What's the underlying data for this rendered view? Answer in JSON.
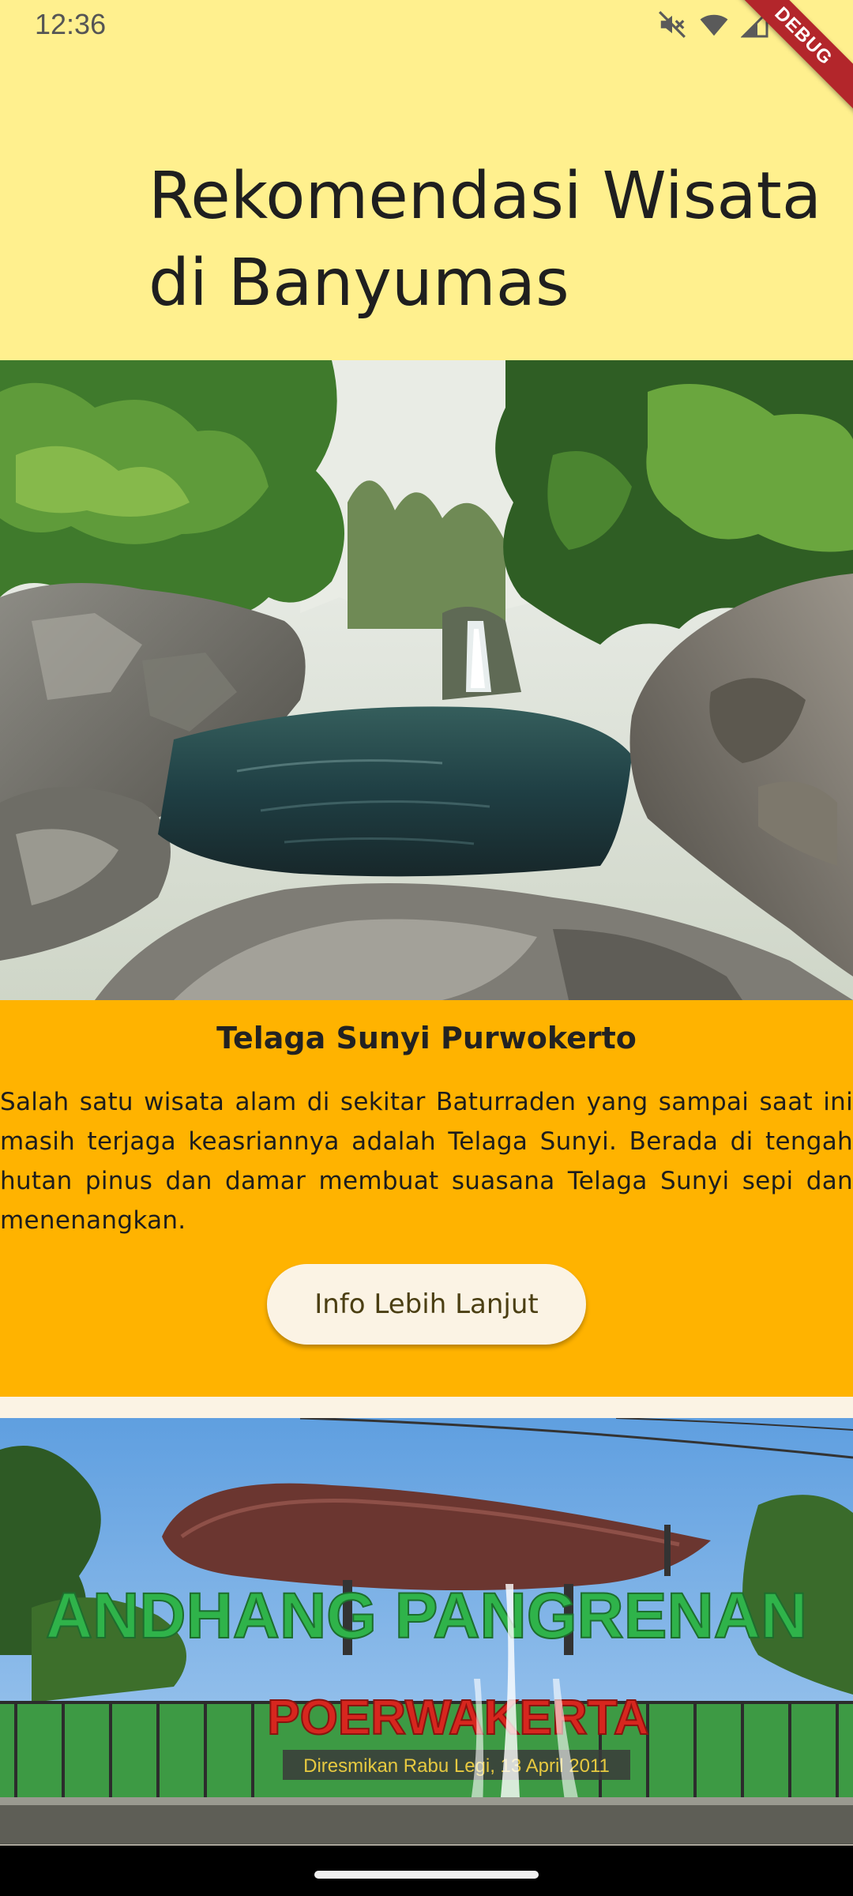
{
  "status_bar": {
    "time": "12:36",
    "icons": [
      "mute-icon",
      "wifi-icon",
      "signal-icon",
      "battery-icon"
    ]
  },
  "debug_banner": "DEBUG",
  "header": {
    "title": "Rekomendasi Wisata di Banyumas"
  },
  "cards": [
    {
      "title": "Telaga Sunyi Purwokerto",
      "description": "Salah satu wisata alam di sekitar Baturraden yang sampai saat ini masih terjaga keasriannya adalah Telaga Sunyi. Berada di tengah hutan pinus dan damar membuat suasana Telaga Sunyi sepi dan menenangkan.",
      "button_label": "Info Lebih Lanjut"
    },
    {
      "sign_text": "ANDHANG PANGRENAN",
      "sign_subtext": "POERWAKERTA",
      "plaque_text": "Diresmikan Rabu Legi, 13 April 2011"
    }
  ],
  "colors": {
    "header_bg": "#fff08e",
    "card_bg": "#ffb300",
    "button_bg": "#fbf3e4",
    "debug_banner": "#b3262b"
  }
}
